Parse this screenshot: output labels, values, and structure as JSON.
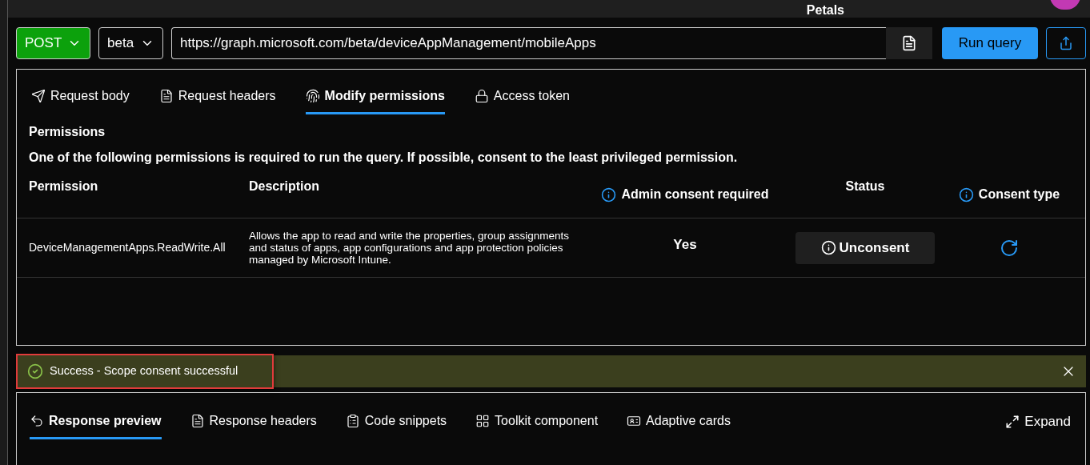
{
  "header": {
    "title": "Petals"
  },
  "query": {
    "method": "POST",
    "version": "beta",
    "url": "https://graph.microsoft.com/beta/deviceAppManagement/mobileApps",
    "run_label": "Run query"
  },
  "request_tabs": [
    {
      "label": "Request body",
      "kind": "send",
      "selected": false
    },
    {
      "label": "Request headers",
      "kind": "headers",
      "selected": false
    },
    {
      "label": "Modify permissions",
      "kind": "permissions",
      "selected": true
    },
    {
      "label": "Access token",
      "kind": "lock",
      "selected": false
    }
  ],
  "permissions": {
    "title": "Permissions",
    "note": "One of the following permissions is required to run the query. If possible, consent to the least privileged permission.",
    "columns": [
      {
        "label": "Permission",
        "info": false
      },
      {
        "label": "Description",
        "info": false
      },
      {
        "label": "Admin consent required",
        "info": true
      },
      {
        "label": "Status",
        "info": false
      },
      {
        "label": "Consent type",
        "info": true
      }
    ],
    "rows": [
      {
        "permission": "DeviceManagementApps.ReadWrite.All",
        "description": "Allows the app to read and write the properties, group assignments and status of apps, app configurations and app protection policies managed by Microsoft Intune.",
        "admin_consent": "Yes",
        "status_action": "Unconsent",
        "consent_type_loading": true
      }
    ]
  },
  "notification": {
    "message": "Success - Scope consent successful",
    "highlighted": true
  },
  "response_tabs": [
    {
      "label": "Response preview",
      "kind": "preview",
      "selected": true
    },
    {
      "label": "Response headers",
      "kind": "headers",
      "selected": false
    },
    {
      "label": "Code snippets",
      "kind": "code",
      "selected": false
    },
    {
      "label": "Toolkit component",
      "kind": "toolkit",
      "selected": false
    },
    {
      "label": "Adaptive cards",
      "kind": "card",
      "selected": false
    }
  ],
  "expand": {
    "label": "Expand"
  }
}
